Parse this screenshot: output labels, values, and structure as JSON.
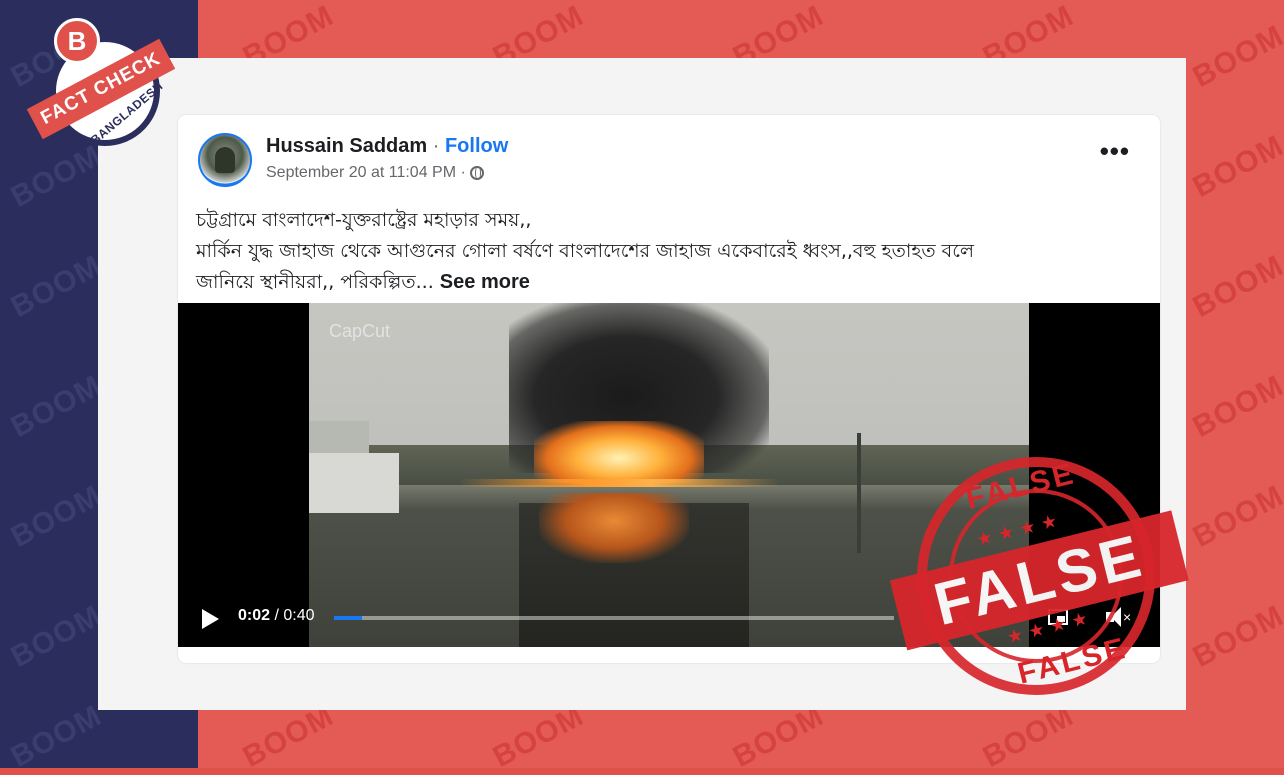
{
  "watermark": "BOOM",
  "badge": {
    "logo_letter": "B",
    "label": "FACT CHECK",
    "country": "BANGLADESH"
  },
  "post": {
    "author": "Hussain Saddam",
    "separator": "·",
    "follow_label": "Follow",
    "timestamp": "September 20 at 11:04 PM",
    "meta_separator": "·",
    "more_label": "•••",
    "caption_line1": "চট্টগ্রামে বাংলাদেশ-যুক্তরাষ্ট্রের মহাড়ার সময়,,",
    "caption_line2": "মার্কিন যুদ্ধ জাহাজ থেকে আগুনের গোলা বর্ষণে বাংলাদেশের জাহাজ একেবারেই ধ্বংস,,বহু হতাহত বলে",
    "caption_line3": "জানিয়ে স্থানীয়রা,, পরিকল্পিত...",
    "see_more": "See more"
  },
  "video": {
    "overlay_text": "CapCut",
    "current_time": "0:02",
    "time_separator": " / ",
    "duration": "0:40",
    "progress_fraction": 0.05
  },
  "stamp": {
    "center": "FALSE",
    "top": "FALSE",
    "bottom": "FALSE",
    "color": "#d7262b"
  },
  "colors": {
    "navy": "#2b2e5c",
    "red": "#e45a55",
    "facebook_blue": "#1877f2"
  }
}
